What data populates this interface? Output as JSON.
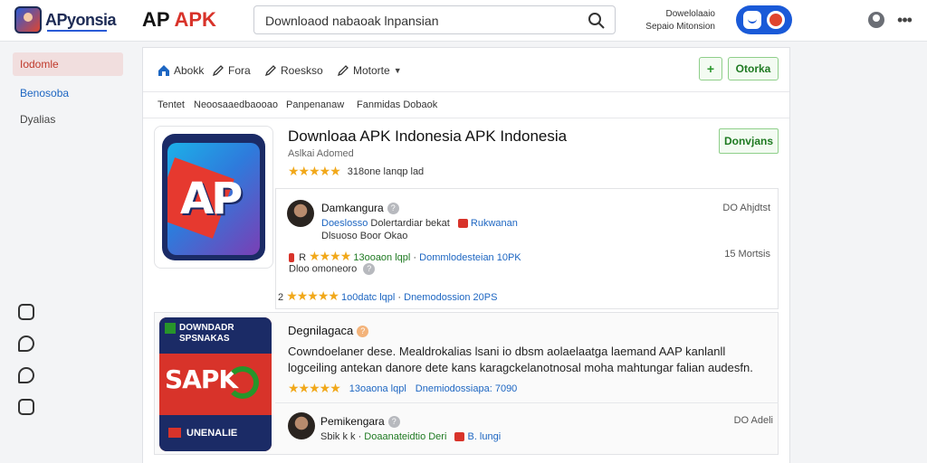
{
  "header": {
    "site_name": "APyonsia",
    "brand_prefix": "AP",
    "brand_suffix": "APK",
    "search_value": "Downloaod nabaoak lnpansian",
    "right_text_line1": "Dowelolaaio",
    "right_text_line2": "Sepaio Mitonsion"
  },
  "sidebar": {
    "items": [
      {
        "label": "Iodomle"
      },
      {
        "label": "Benosoba"
      },
      {
        "label": "Dyalias"
      }
    ]
  },
  "toolbar": {
    "items": [
      {
        "label": "Abokk"
      },
      {
        "label": "Fora"
      },
      {
        "label": "Roeskso"
      },
      {
        "label": "Motorte"
      }
    ],
    "action_label": "Otorka"
  },
  "tabs": [
    "Tentet",
    "Neoosaaedbaooao",
    "Panpenanaw",
    "Fanmidas Dobaok"
  ],
  "app": {
    "title": "Downloaa APK Indonesia APK Indonesia",
    "subtitle": "Aslkai Adomed",
    "rating_text": "318one lanqp lad",
    "download_label": "Donvjans"
  },
  "reviews": [
    {
      "name": "Damkangura",
      "meta": "DO Ahjdtst",
      "line1_a": "Doeslosso",
      "line1_b": "Dolertardiar bekat",
      "line1_c": "Rukwanan",
      "line2": "Dlsuoso Boor Okao"
    }
  ],
  "review_stats": [
    {
      "prefix": "R",
      "a": "13ooaon lqpl",
      "b": "Dommlodesteian 10PK",
      "meta": "15 Mortsis"
    },
    {
      "prefix": "2",
      "a": "1o0datc lqpl",
      "b": "Dnemodossion 20PS",
      "meta": ""
    }
  ],
  "review_extra": "Dloo omoneoro",
  "app2": {
    "icon_top_line1": "DOWNDADR",
    "icon_top_line2": "SPSNAKAS",
    "icon_mid": "SAPK",
    "icon_bot": "UNENALIE",
    "name": "Degnilagaca",
    "description": "Cowndoelaner dese. Mealdrokalias lsani io dbsm aolaelaatga laemand AAP kanlanll logceiling antekan danore dete kans karagckelanotnosal moha mahtungar falian audesfn.",
    "stat_a": "13oaona lqpl",
    "stat_b": "Dnemiodossiapa: 7090",
    "reviewer_name": "Pemikengara",
    "reviewer_meta": "DO Adeli",
    "reviewer_line": "Sbik k k",
    "reviewer_line2": "Doaanateidtio Deri",
    "reviewer_line3": "B. lungi"
  },
  "colors": {
    "accent_blue": "#1a5ad8",
    "accent_red": "#d8332a",
    "accent_green": "#27952a",
    "star": "#f1a81a"
  }
}
